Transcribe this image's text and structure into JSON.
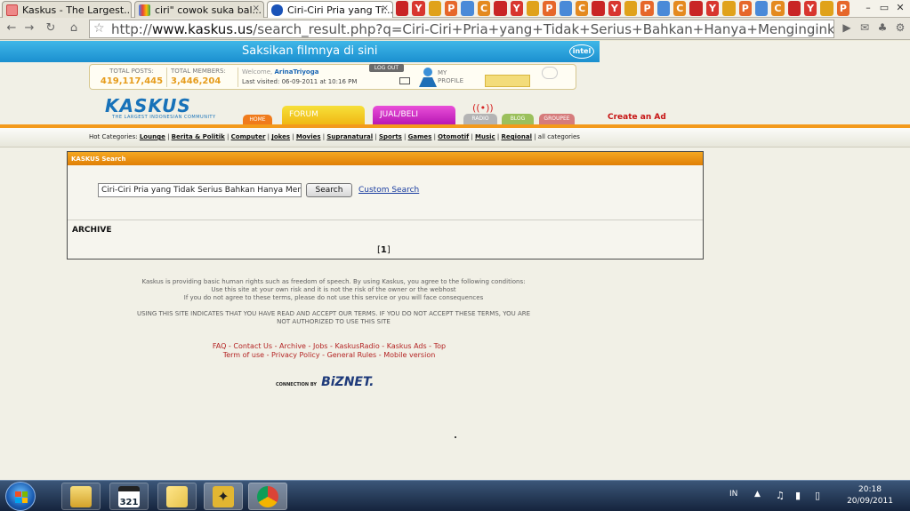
{
  "browser": {
    "tabs": [
      {
        "title": "Kaskus - The Largest...",
        "favicon": "kaskus-favicon",
        "active": false
      },
      {
        "title": "ciri\" cowok suka bal...",
        "favicon": "google-favicon",
        "active": false
      },
      {
        "title": "Ciri-Ciri Pria yang Ti...",
        "favicon": "kaskus-favicon",
        "active": true
      }
    ],
    "tab_close_glyph": "×",
    "pinned_icons": [
      "red-guy",
      "Y",
      "trophy",
      "P",
      "face",
      "C",
      "red-guy",
      "Y",
      "trophy",
      "P",
      "face",
      "C",
      "red-guy",
      "Y",
      "trophy",
      "P",
      "face",
      "C",
      "red-guy",
      "Y",
      "trophy",
      "P",
      "face",
      "C",
      "red-guy",
      "Y",
      "trophy",
      "P"
    ],
    "window_controls": [
      "–",
      "▭",
      "✕"
    ],
    "url_prefix": "http://",
    "url_host": "www.kaskus.us",
    "url_rest": "/search_result.php?q=Ciri-Ciri+Pria+yang+Tidak+Serius+Bahkan+Hanya+Menginginkan+Seks++Sumber:+http://id."
  },
  "site": {
    "ad_banner": "Saksikan filmnya di sini",
    "ad_logo": "intel",
    "stats": {
      "posts_label": "TOTAL POSTS:",
      "posts_value": "419,117,445",
      "members_label": "TOTAL MEMBERS:",
      "members_value": "3,446,204"
    },
    "welcome_prefix": "Welcome, ",
    "username": "ArinaTriyoga",
    "last_visited": "Last visited: 06-09-2011 at 10:16 PM",
    "logout_label": "LOG OUT",
    "my_profile_label": "MY PROFILE",
    "logo_text": "KASKUS",
    "logo_subtitle": "THE LARGEST INDONESIAN COMMUNITY",
    "nav_tabs": {
      "home": "HOME",
      "forum": "FORUM",
      "jual_beli": "JUAL/BELI",
      "radio": "RADIO",
      "blog": "BLOG",
      "groupee": "GROUPEE"
    },
    "create_ad": "Create an Ad",
    "hot_categories_label": "Hot Categories:",
    "hot_categories": [
      "Lounge",
      "Berita & Politik",
      "Computer",
      "Jokes",
      "Movies",
      "Supranatural",
      "Sports",
      "Games",
      "Otomotif",
      "Music",
      "Regional"
    ],
    "all_categories": "all categories"
  },
  "search": {
    "header": "KASKUS Search",
    "query_value": "Ciri-Ciri Pria yang Tidak Serius Bahkan Hanya Meng",
    "button_label": "Search",
    "custom_search_label": "Custom Search",
    "archive_label": "ARCHIVE",
    "page_indicator_open": "[",
    "page_indicator_num": "1",
    "page_indicator_close": "]"
  },
  "footer": {
    "disclaimer_1": "Kaskus is providing basic human rights such as freedom of speech. By using Kaskus, you agree to the following conditions:",
    "disclaimer_2": "Use this site at your own risk and it is not the risk of the owner or the webhost",
    "disclaimer_3": "If you do not agree to these terms, please do not use this service or you will face consequences",
    "terms_1": "USING THIS SITE INDICATES THAT YOU HAVE READ AND ACCEPT OUR TERMS. IF YOU DO NOT ACCEPT THESE TERMS, YOU ARE",
    "terms_2": "NOT AUTHORIZED TO USE THIS SITE",
    "links_row1": [
      "FAQ",
      "Contact Us",
      "Archive",
      "Jobs",
      "KaskusRadio",
      "Kaskus Ads",
      "Top"
    ],
    "links_row2": [
      "Term of use",
      "Privacy Policy",
      "General Rules",
      "Mobile version"
    ],
    "connection_label": "CONNECTION BY",
    "connection_brand": "BiZNET."
  },
  "taskbar": {
    "apps": [
      "explorer-icon",
      "calendar-icon",
      "sticky-notes-icon",
      "bird-app-icon",
      "chrome-icon"
    ],
    "calendar_number": "321",
    "language": "IN",
    "time": "20:18",
    "date": "20/09/2011"
  }
}
